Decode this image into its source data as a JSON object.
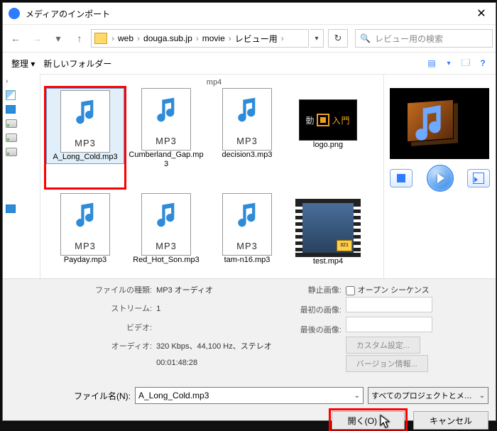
{
  "icons": {
    "nav_back": "←",
    "nav_fwd": "→",
    "nav_drop": "▾",
    "nav_up": "↑",
    "crumb_sep": "›",
    "refresh": "↻",
    "search": "🔍",
    "toolbar_drop": "▾",
    "view": "📄",
    "help": "?",
    "close": "✕",
    "combo_drop": "⌄"
  },
  "title": "メディアのインポート",
  "breadcrumb": [
    "web",
    "douga.sub.jp",
    "movie",
    "レビュー用"
  ],
  "search_placeholder": "レビュー用の検索",
  "toolbar": {
    "organize": "整理 ▾",
    "new_folder": "新しいフォルダー"
  },
  "tree": [
    {
      "kind": "expand",
      "label": ""
    },
    {
      "kind": "pics",
      "label": ""
    },
    {
      "kind": "desk",
      "label": ""
    },
    {
      "kind": "drv",
      "label": ""
    },
    {
      "kind": "drv",
      "label": ""
    },
    {
      "kind": "drv",
      "label": ""
    },
    {
      "kind": "desk",
      "label": ""
    }
  ],
  "truncated_above": "mp4",
  "files": [
    {
      "name": "A_Long_Cold.mp3",
      "type": "mp3",
      "selected": true,
      "highlight": true
    },
    {
      "name": "Cumberland_Gap.mp3",
      "type": "mp3"
    },
    {
      "name": "decision3.mp3",
      "type": "mp3"
    },
    {
      "name": "logo.png",
      "type": "logo"
    },
    {
      "name": "Payday.mp3",
      "type": "mp3"
    },
    {
      "name": "Red_Hot_Son.mp3",
      "type": "mp3"
    },
    {
      "name": "tam-n16.mp3",
      "type": "mp3"
    },
    {
      "name": "test.mp4",
      "type": "video"
    }
  ],
  "logo_text": "入門",
  "mpc_badge": "321",
  "info": {
    "file_type_label": "ファイルの種類:",
    "file_type_value": "MP3 オーディオ",
    "stream_label": "ストリーム:",
    "stream_value": "1",
    "video_label": "ビデオ:",
    "video_value": "",
    "audio_label": "オーディオ:",
    "audio_value": "320 Kbps、44,100 Hz、ステレオ",
    "duration_value": "00:01:48:28",
    "still_label": "静止画像:",
    "still_check": "オープン シーケンス",
    "first_label": "最初の画像:",
    "last_label": "最後の画像:",
    "custom_btn": "カスタム設定...",
    "version_btn": "バージョン情報..."
  },
  "file_name_label": "ファイル名(N):",
  "file_name_value": "A_Long_Cold.mp3",
  "file_type_filter": "すべてのプロジェクトとメディア ファイル",
  "open_btn": "開く(O)",
  "cancel_btn": "キャンセル",
  "mp3_badge": "MP3"
}
